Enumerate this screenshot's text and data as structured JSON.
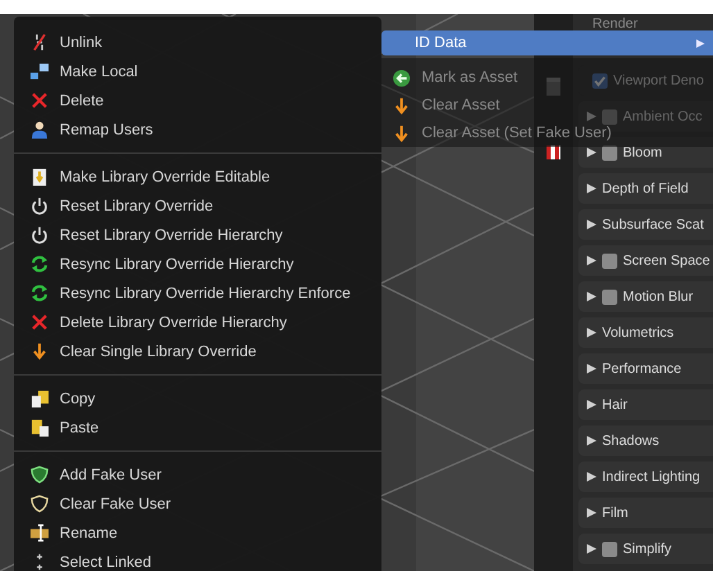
{
  "context_menu": {
    "sections": [
      {
        "items": [
          {
            "label": "Unlink"
          },
          {
            "label": "Make Local"
          },
          {
            "label": "Delete"
          },
          {
            "label": "Remap Users"
          }
        ]
      },
      {
        "items": [
          {
            "label": "Make Library Override Editable"
          },
          {
            "label": "Reset Library Override"
          },
          {
            "label": "Reset Library Override Hierarchy"
          },
          {
            "label": "Resync Library Override Hierarchy"
          },
          {
            "label": "Resync Library Override Hierarchy Enforce"
          },
          {
            "label": "Delete Library Override Hierarchy"
          },
          {
            "label": "Clear Single Library Override"
          }
        ]
      },
      {
        "items": [
          {
            "label": "Copy"
          },
          {
            "label": "Paste"
          }
        ]
      },
      {
        "items": [
          {
            "label": "Add Fake User"
          },
          {
            "label": "Clear Fake User"
          },
          {
            "label": "Rename"
          },
          {
            "label": "Select Linked"
          }
        ]
      }
    ]
  },
  "submenu": {
    "title": "ID Data",
    "selected": true,
    "items": [
      {
        "label": "Mark as Asset"
      },
      {
        "label": "Clear Asset"
      },
      {
        "label": "Clear Asset (Set Fake User)"
      }
    ]
  },
  "properties": {
    "heading": "Render",
    "panels": [
      {
        "kind": "option",
        "label": "Viewport Deno",
        "checked": true
      },
      {
        "kind": "checkbox",
        "label": "Ambient Occ",
        "checked": false
      },
      {
        "kind": "checkbox",
        "label": "Bloom",
        "checked": false
      },
      {
        "kind": "plain",
        "label": "Depth of Field"
      },
      {
        "kind": "plain",
        "label": "Subsurface Scat"
      },
      {
        "kind": "checkbox",
        "label": "Screen Space",
        "checked": false
      },
      {
        "kind": "checkbox",
        "label": "Motion Blur",
        "checked": false
      },
      {
        "kind": "plain",
        "label": "Volumetrics"
      },
      {
        "kind": "plain",
        "label": "Performance"
      },
      {
        "kind": "plain",
        "label": "Hair"
      },
      {
        "kind": "plain",
        "label": "Shadows"
      },
      {
        "kind": "plain",
        "label": "Indirect Lighting"
      },
      {
        "kind": "plain",
        "label": "Film"
      },
      {
        "kind": "checkbox",
        "label": "Simplify",
        "checked": false
      }
    ]
  }
}
